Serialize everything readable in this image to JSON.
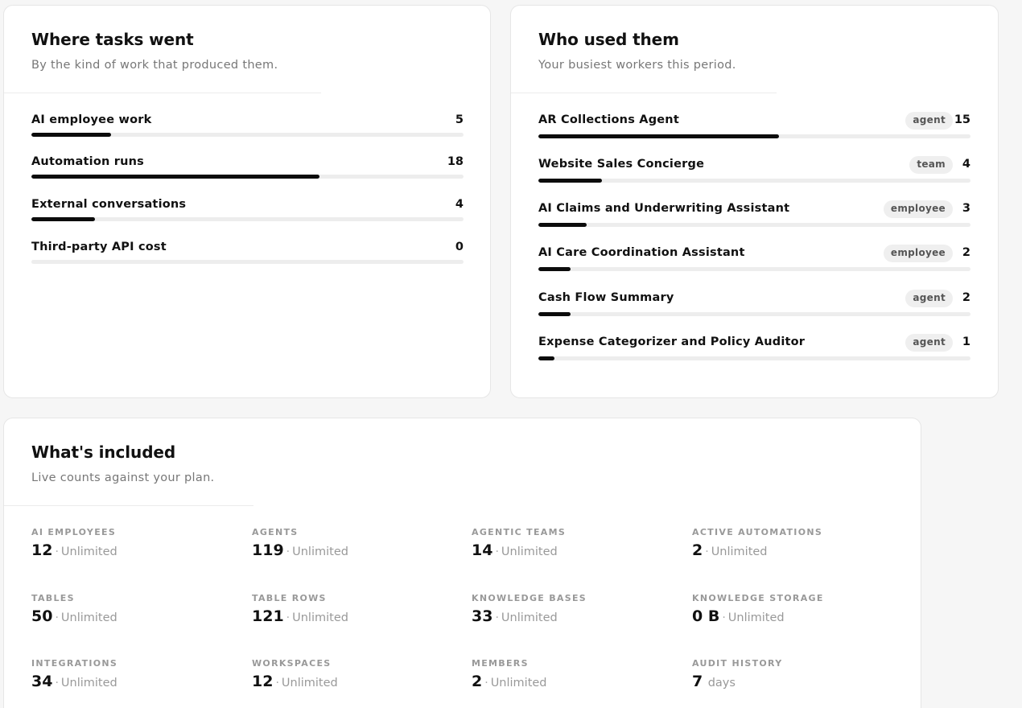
{
  "tasks_card": {
    "title": "Where tasks went",
    "subtitle": "By the kind of work that produced them.",
    "rows": [
      {
        "label": "AI employee work",
        "value": 5,
        "share": 0.185
      },
      {
        "label": "Automation runs",
        "value": 18,
        "share": 0.667
      },
      {
        "label": "External conversations",
        "value": 4,
        "share": 0.148
      },
      {
        "label": "Third-party API cost",
        "value": 0,
        "share": 0
      }
    ]
  },
  "users_card": {
    "title": "Who used them",
    "subtitle": "Your busiest workers this period.",
    "rows": [
      {
        "label": "AR Collections Agent",
        "tag": "agent",
        "value": 15,
        "share": 0.556
      },
      {
        "label": "Website Sales Concierge",
        "tag": "team",
        "value": 4,
        "share": 0.148
      },
      {
        "label": "AI Claims and Underwriting Assistant",
        "tag": "employee",
        "value": 3,
        "share": 0.111
      },
      {
        "label": "AI Care Coordination Assistant",
        "tag": "employee",
        "value": 2,
        "share": 0.074
      },
      {
        "label": "Cash Flow Summary",
        "tag": "agent",
        "value": 2,
        "share": 0.074
      },
      {
        "label": "Expense Categorizer and Policy Auditor",
        "tag": "agent",
        "value": 1,
        "share": 0.037
      }
    ]
  },
  "included_card": {
    "title": "What's included",
    "subtitle": "Live counts against your plan.",
    "separator": "·",
    "stats": [
      {
        "label": "AI EMPLOYEES",
        "value": "12",
        "limit": "Unlimited"
      },
      {
        "label": "AGENTS",
        "value": "119",
        "limit": "Unlimited"
      },
      {
        "label": "AGENTIC TEAMS",
        "value": "14",
        "limit": "Unlimited"
      },
      {
        "label": "ACTIVE AUTOMATIONS",
        "value": "2",
        "limit": "Unlimited"
      },
      {
        "label": "TABLES",
        "value": "50",
        "limit": "Unlimited"
      },
      {
        "label": "TABLE ROWS",
        "value": "121",
        "limit": "Unlimited"
      },
      {
        "label": "KNOWLEDGE BASES",
        "value": "33",
        "limit": "Unlimited"
      },
      {
        "label": "KNOWLEDGE STORAGE",
        "value": "0 B",
        "limit": "Unlimited"
      },
      {
        "label": "INTEGRATIONS",
        "value": "34",
        "limit": "Unlimited"
      },
      {
        "label": "WORKSPACES",
        "value": "12",
        "limit": "Unlimited"
      },
      {
        "label": "MEMBERS",
        "value": "2",
        "limit": "Unlimited"
      },
      {
        "label": "AUDIT HISTORY",
        "value": "7",
        "limit": "days",
        "no_separator": true
      }
    ]
  },
  "colors": {
    "bar_fill": "#0c0c0c",
    "bar_track": "#ededed",
    "tag_bg": "#efefef",
    "muted_text": "#999999"
  }
}
